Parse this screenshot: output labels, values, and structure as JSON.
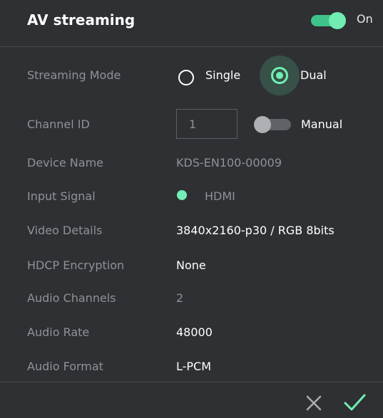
{
  "header": {
    "title": "AV streaming",
    "toggle_label": "On"
  },
  "streaming_mode": {
    "label": "Streaming Mode",
    "options": [
      {
        "label": "Single",
        "selected": false
      },
      {
        "label": "Dual",
        "selected": true
      }
    ]
  },
  "channel_id": {
    "label": "Channel ID",
    "value": "1",
    "manual_label": "Manual",
    "manual_enabled": false
  },
  "device_name": {
    "label": "Device Name",
    "value": "KDS-EN100-00009"
  },
  "input_signal": {
    "label": "Input Signal",
    "value": "HDMI"
  },
  "video_details": {
    "label": "Video Details",
    "value": "3840x2160-p30 / RGB 8bits"
  },
  "hdcp_encryption": {
    "label": "HDCP Encryption",
    "value": "None"
  },
  "audio_channels": {
    "label": "Audio Channels",
    "value": "2"
  },
  "audio_rate": {
    "label": "Audio Rate",
    "value": "48000"
  },
  "audio_format": {
    "label": "Audio Format",
    "value": "L-PCM"
  },
  "footer": {
    "cancel_icon": "close-icon",
    "confirm_icon": "check-icon"
  },
  "colors": {
    "background": "#2e3033",
    "accent": "#6ff0b2",
    "label": "#8e9296",
    "value": "#ffffff"
  }
}
